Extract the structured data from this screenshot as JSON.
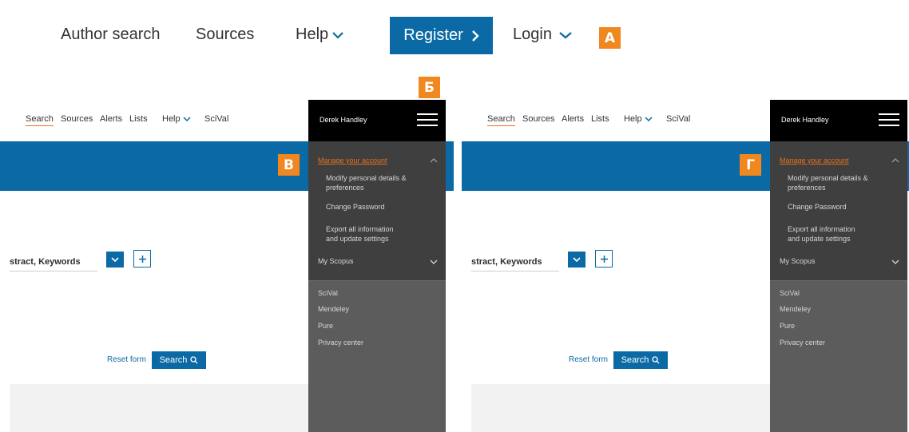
{
  "top_nav": {
    "author_search": "Author search",
    "sources": "Sources",
    "help": "Help",
    "register": "Register",
    "login": "Login"
  },
  "badges": {
    "a": "А",
    "b": "Б",
    "v": "В",
    "g": "Г"
  },
  "panel_nav": {
    "search": "Search",
    "sources": "Sources",
    "alerts": "Alerts",
    "lists": "Lists",
    "help": "Help",
    "scival": "SciVal"
  },
  "search_form": {
    "field_text": "stract, Keywords",
    "reset": "Reset form",
    "search_button": "Search"
  },
  "side_menu": {
    "user": "Derek Handley",
    "section_title": "Manage your account",
    "items": [
      "Modify personal details &",
      "preferences",
      "Change Password",
      "Export all information",
      "and update settings"
    ],
    "my_scopus": "My Scopus",
    "links": [
      "SciVal",
      "Mendeley",
      "Pure",
      "Privacy center"
    ]
  },
  "colors": {
    "accent_blue": "#0b6aa5",
    "accent_orange": "#f0871f",
    "menu_dark": "#3f3f3f",
    "menu_header": "#000000"
  }
}
